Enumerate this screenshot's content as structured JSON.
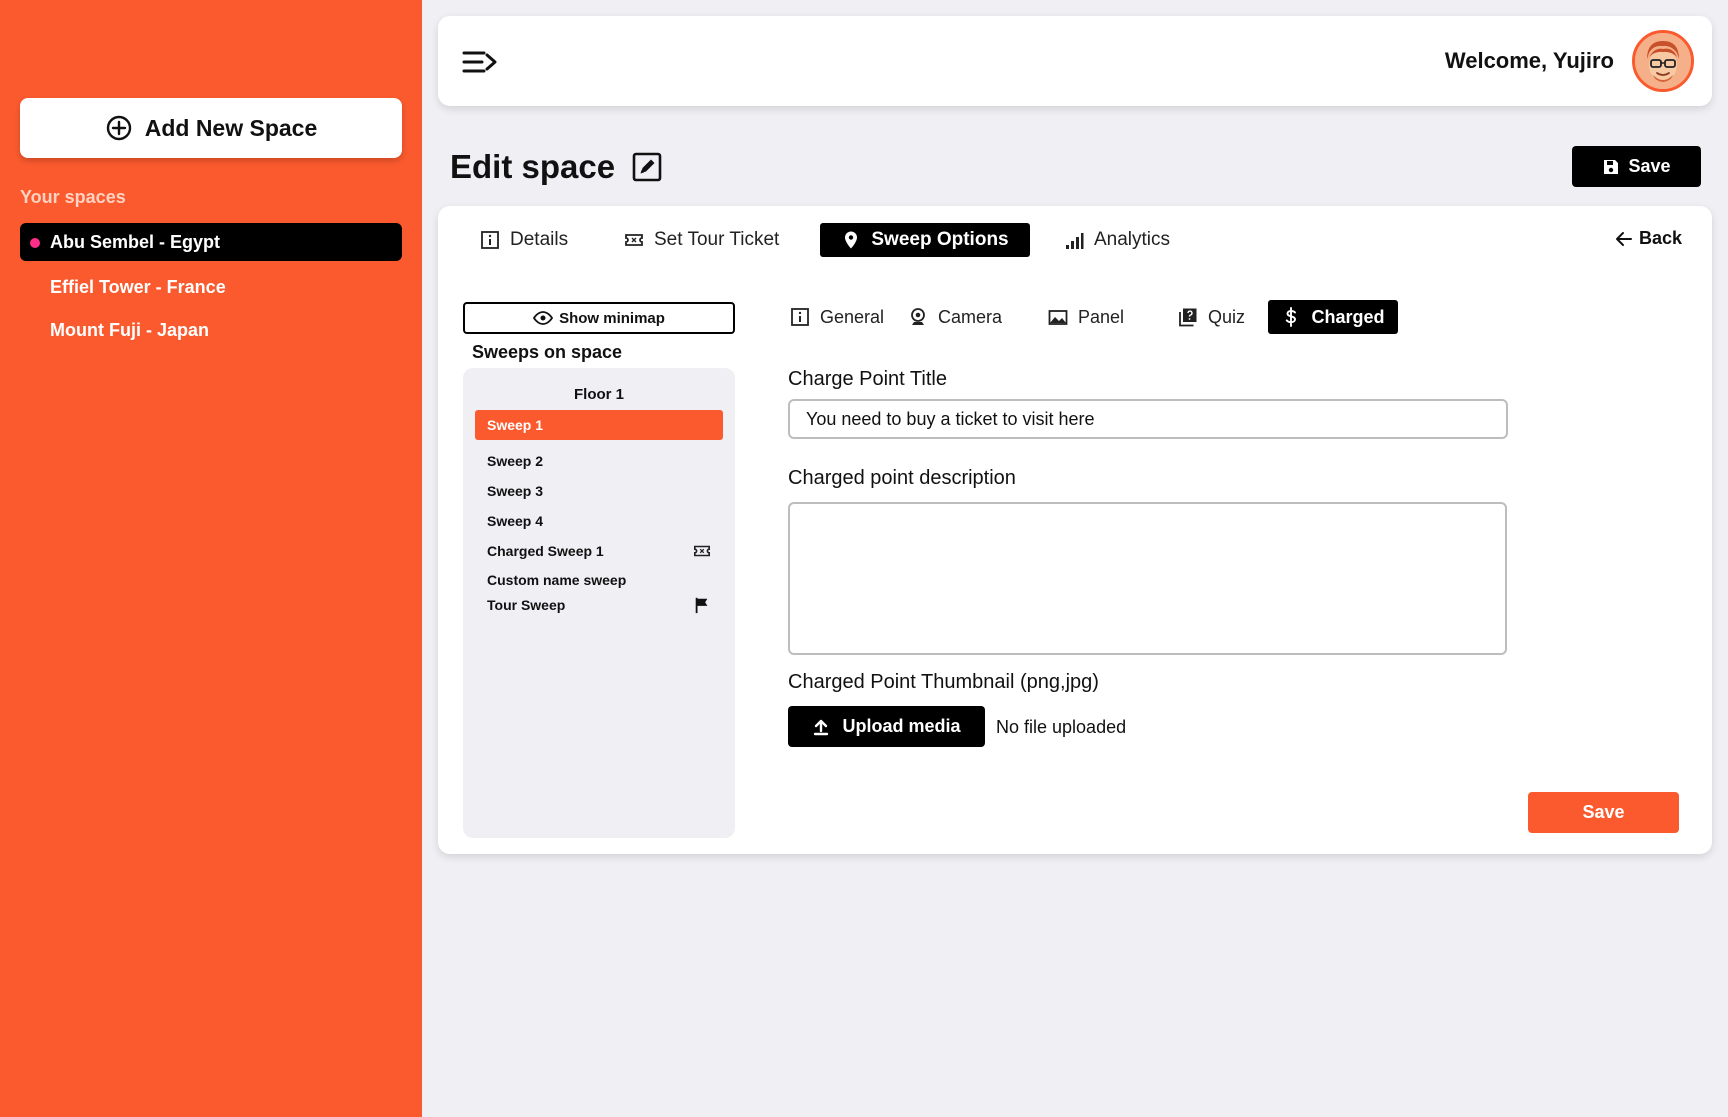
{
  "sidebar": {
    "add_button_label": "Add New Space",
    "spaces_heading": "Your spaces",
    "spaces": [
      {
        "label": "Abu Sembel - Egypt",
        "active": true
      },
      {
        "label": "Effiel Tower - France",
        "active": false
      },
      {
        "label": "Mount Fuji - Japan",
        "active": false
      }
    ]
  },
  "header": {
    "welcome_text": "Welcome, Yujiro"
  },
  "page": {
    "title": "Edit space",
    "save_label": "Save"
  },
  "tabs": [
    {
      "label": "Details",
      "icon": "info-icon",
      "active": false
    },
    {
      "label": "Set Tour Ticket",
      "icon": "ticket-icon",
      "active": false
    },
    {
      "label": "Sweep Options",
      "icon": "map-pin-icon",
      "active": true
    },
    {
      "label": "Analytics",
      "icon": "bar-chart-icon",
      "active": false
    }
  ],
  "back_label": "Back",
  "sweeps": {
    "minimap_button": "Show minimap",
    "heading": "Sweeps on space",
    "floor_label": "Floor 1",
    "items": [
      {
        "label": "Sweep 1",
        "active": true,
        "icon": ""
      },
      {
        "label": "Sweep 2",
        "active": false,
        "icon": ""
      },
      {
        "label": "Sweep 3",
        "active": false,
        "icon": ""
      },
      {
        "label": "Sweep 4",
        "active": false,
        "icon": ""
      },
      {
        "label": "Charged Sweep 1",
        "active": false,
        "icon": "ticket-icon"
      },
      {
        "label": "Custom name sweep",
        "active": false,
        "icon": ""
      },
      {
        "label": "Tour Sweep",
        "active": false,
        "icon": "flag-icon"
      }
    ]
  },
  "subtabs": [
    {
      "label": "General",
      "icon": "info-icon",
      "active": false
    },
    {
      "label": "Camera",
      "icon": "webcam-icon",
      "active": false
    },
    {
      "label": "Panel",
      "icon": "image-icon",
      "active": false
    },
    {
      "label": "Quiz",
      "icon": "quiz-icon",
      "active": false
    },
    {
      "label": "Charged",
      "icon": "dollar-icon",
      "active": true
    }
  ],
  "form": {
    "title_label": "Charge Point Title",
    "title_value": "You need to buy a ticket to visit here",
    "description_label": "Charged point description",
    "description_value": "",
    "thumbnail_label": "Charged Point Thumbnail (png,jpg)",
    "upload_label": "Upload media",
    "upload_status": "No file uploaded",
    "save_label": "Save"
  },
  "colors": {
    "accent": "#fa5a2e",
    "active_dot": "#ff2d8a",
    "background": "#f0eff4"
  }
}
